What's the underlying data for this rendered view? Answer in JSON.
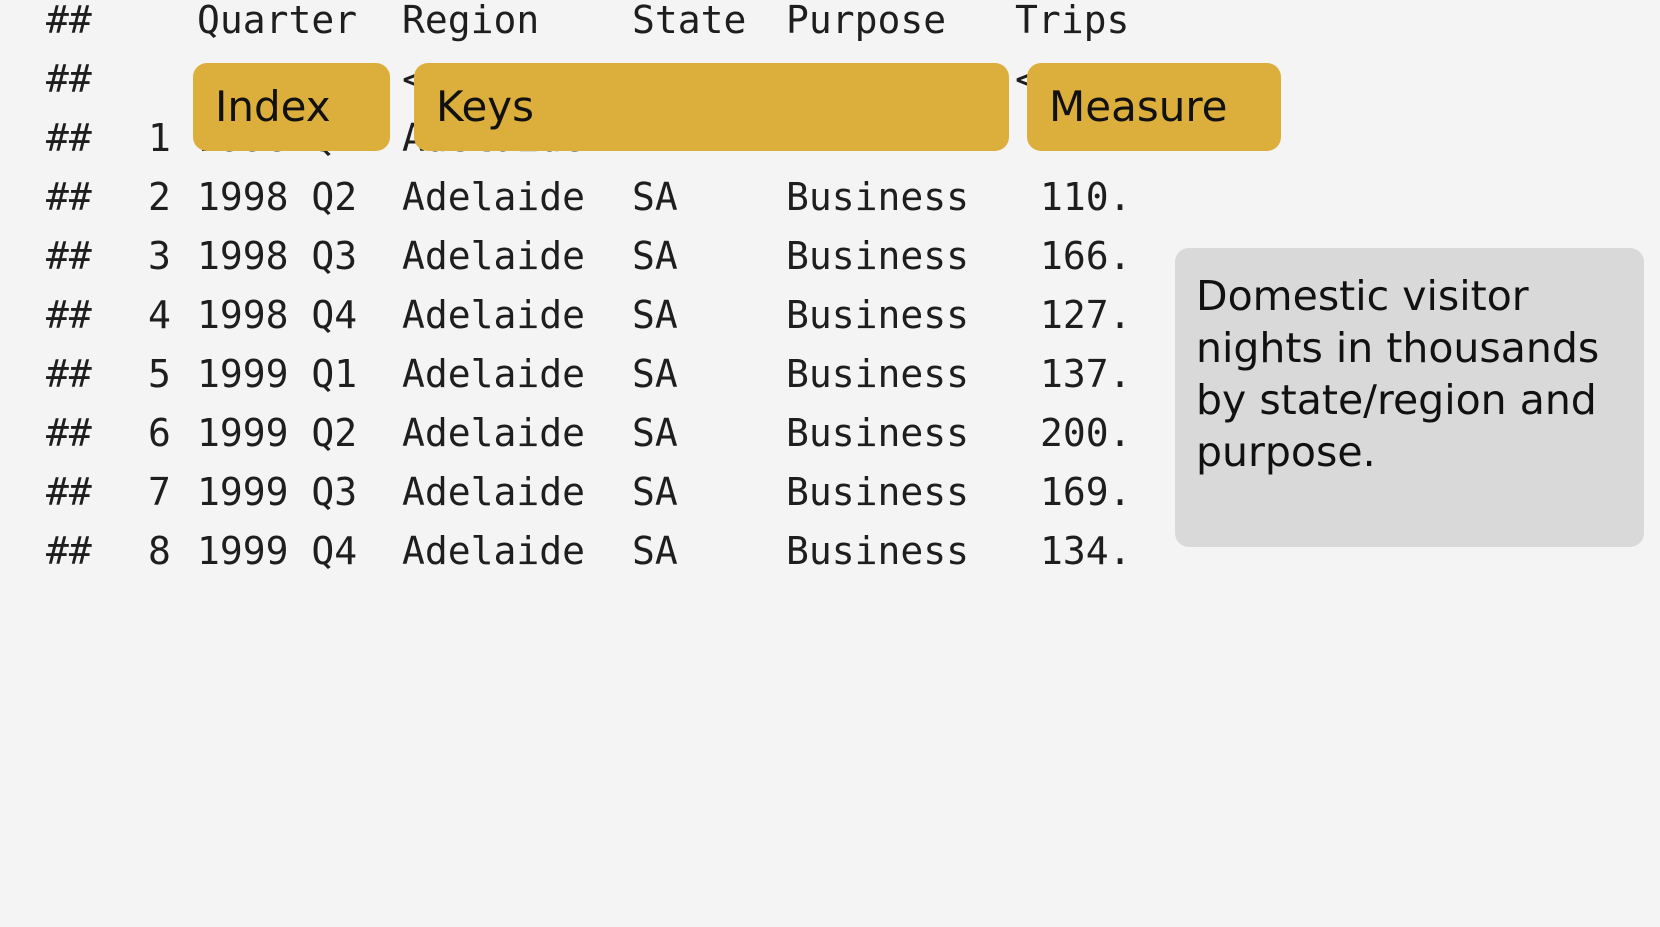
{
  "header": {
    "prefix": "##",
    "columns": [
      "Quarter",
      "Region",
      "State",
      "Purpose",
      "Trips"
    ]
  },
  "types_row": {
    "prefix": "##",
    "visible_fragments": [
      "<",
      "<",
      "<"
    ]
  },
  "rows": [
    {
      "prefix": "##",
      "index": "1",
      "quarter": "1998 Q1",
      "region": "Adelaide",
      "state": "",
      "purpose": "",
      "trips": ""
    },
    {
      "prefix": "##",
      "index": "2",
      "quarter": "1998 Q2",
      "region": "Adelaide",
      "state": "SA",
      "purpose": "Business",
      "trips": "110."
    },
    {
      "prefix": "##",
      "index": "3",
      "quarter": "1998 Q3",
      "region": "Adelaide",
      "state": "SA",
      "purpose": "Business",
      "trips": "166."
    },
    {
      "prefix": "##",
      "index": "4",
      "quarter": "1998 Q4",
      "region": "Adelaide",
      "state": "SA",
      "purpose": "Business",
      "trips": "127."
    },
    {
      "prefix": "##",
      "index": "5",
      "quarter": "1999 Q1",
      "region": "Adelaide",
      "state": "SA",
      "purpose": "Business",
      "trips": "137."
    },
    {
      "prefix": "##",
      "index": "6",
      "quarter": "1999 Q2",
      "region": "Adelaide",
      "state": "SA",
      "purpose": "Business",
      "trips": "200."
    },
    {
      "prefix": "##",
      "index": "7",
      "quarter": "1999 Q3",
      "region": "Adelaide",
      "state": "SA",
      "purpose": "Business",
      "trips": "169."
    },
    {
      "prefix": "##",
      "index": "8",
      "quarter": "1999 Q4",
      "region": "Adelaide",
      "state": "SA",
      "purpose": "Business",
      "trips": "134."
    }
  ],
  "labels": {
    "index": "Index",
    "keys": "Keys",
    "measure": "Measure"
  },
  "note": "Domestic visitor nights in thousands by state/region and purpose.",
  "colors": {
    "background": "#f4f4f4",
    "label_fill": "#dcae3c",
    "note_fill": "#d9d9d9",
    "text": "#1e1e1e"
  }
}
